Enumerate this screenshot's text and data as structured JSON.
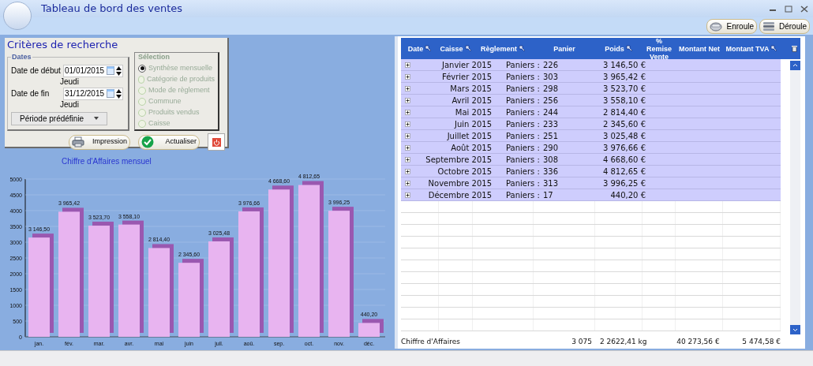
{
  "window": {
    "title": "Tableau de bord des ventes"
  },
  "toolbar": {
    "buttons": [
      {
        "label": "Enroule",
        "kind": "collapse"
      },
      {
        "label": "Déroule",
        "kind": "expand"
      }
    ]
  },
  "criteria": {
    "title": "Critères de recherche",
    "dates": {
      "title": "Dates",
      "start": {
        "label": "Date de début",
        "value": "01/01/2015",
        "weekday": "Jeudi"
      },
      "end": {
        "label": "Date de fin",
        "value": "31/12/2015",
        "weekday": "Jeudi"
      },
      "preset": "Période prédéfinie"
    },
    "selection": {
      "title": "Sélection",
      "disabled": true,
      "options": [
        {
          "label": "Synthèse mensuelle",
          "selected": true
        },
        {
          "label": "Catégorie de produits",
          "selected": false
        },
        {
          "label": "Mode de règlement",
          "selected": false
        },
        {
          "label": "Commune",
          "selected": false
        },
        {
          "label": "Produits vendus",
          "selected": false
        },
        {
          "label": "Caisse",
          "selected": false
        }
      ]
    },
    "buttons": [
      {
        "label": "Impression",
        "kind": "print"
      },
      {
        "label": "Actualiser",
        "kind": "refresh"
      }
    ]
  },
  "chart": {
    "chart_data": {
      "type": "bar",
      "title": "Chiffre d'Affaires mensuel",
      "categories": [
        "jan.",
        "fév.",
        "mar.",
        "avr.",
        "mai",
        "juin",
        "juil.",
        "aoû.",
        "sep.",
        "oct.",
        "nov.",
        "déc."
      ],
      "grid": true,
      "series": [
        {
          "color": "#e8b4f0",
          "values": [
            3146.5,
            3965.42,
            3523.7,
            3558.1,
            2814.4,
            2345.6,
            3025.48,
            3976.66,
            4668.6,
            4812.65,
            3996.25,
            440.2
          ]
        }
      ],
      "ylim": [
        0,
        5000
      ],
      "yticks": [
        0,
        500,
        1000,
        1500,
        2000,
        2500,
        3000,
        3500,
        4000,
        4500,
        5000
      ],
      "value_labels": [
        "3 146,50",
        "3 965,42",
        "3 523,70",
        "3 558,10",
        "2 814,40",
        "2 345,60",
        "3 025,48",
        "3 976,66",
        "4 668,60",
        "4 812,65",
        "3 996,25",
        "440,20"
      ]
    }
  },
  "grid": {
    "columns": [
      {
        "label": "Date",
        "filter": true
      },
      {
        "label": "Caisse",
        "filter": true
      },
      {
        "label": "Règlement",
        "filter": true
      },
      {
        "label": "Panier",
        "filter": false
      },
      {
        "label": "Poids",
        "filter": true
      },
      {
        "label": "% Remise Vente",
        "filter": false
      },
      {
        "label": "Montant Net",
        "filter": false
      },
      {
        "label": "Montant TVA",
        "filter": true
      }
    ],
    "rows": [
      {
        "date": "Janvier 2015",
        "label": "Paniers :",
        "count": "226",
        "amount": "3 146,50 €"
      },
      {
        "date": "Février 2015",
        "label": "Paniers :",
        "count": "303",
        "amount": "3 965,42 €"
      },
      {
        "date": "Mars 2015",
        "label": "Paniers :",
        "count": "298",
        "amount": "3 523,70 €"
      },
      {
        "date": "Avril 2015",
        "label": "Paniers :",
        "count": "256",
        "amount": "3 558,10 €"
      },
      {
        "date": "Mai 2015",
        "label": "Paniers :",
        "count": "244",
        "amount": "2 814,40 €"
      },
      {
        "date": "Juin 2015",
        "label": "Paniers :",
        "count": "233",
        "amount": "2 345,60 €"
      },
      {
        "date": "Juillet 2015",
        "label": "Paniers :",
        "count": "251",
        "amount": "3 025,48 €"
      },
      {
        "date": "Août 2015",
        "label": "Paniers :",
        "count": "290",
        "amount": "3 976,66 €"
      },
      {
        "date": "Septembre 2015",
        "label": "Paniers :",
        "count": "308",
        "amount": "4 668,60 €"
      },
      {
        "date": "Octobre 2015",
        "label": "Paniers :",
        "count": "336",
        "amount": "4 812,65 €"
      },
      {
        "date": "Novembre 2015",
        "label": "Paniers :",
        "count": "313",
        "amount": "3 996,25 €"
      },
      {
        "date": "Décembre 2015",
        "label": "Paniers :",
        "count": "17",
        "amount": "440,20 €"
      }
    ],
    "footer": {
      "label": "Chiffre d'Affaires",
      "panier": "3 075",
      "poids": "2 2622,41 kg",
      "net": "40 273,56 €",
      "tva": "5 474,58 €"
    }
  }
}
